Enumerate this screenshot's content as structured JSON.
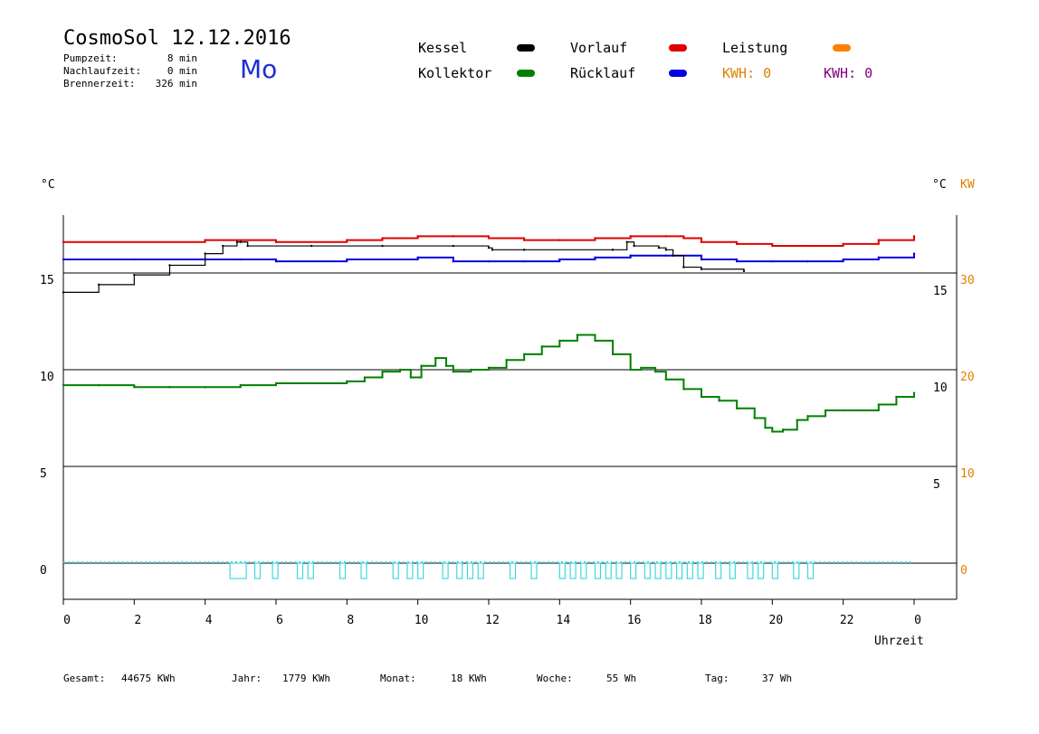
{
  "header": {
    "title": "CosmoSol 12.12.2016",
    "day": "Mo",
    "stats": [
      {
        "label": "Pumpzeit:",
        "value": "8 min"
      },
      {
        "label": "Nachlaufzeit:",
        "value": "0 min"
      },
      {
        "label": "Brennerzeit:",
        "value": "326 min"
      }
    ]
  },
  "legend": {
    "items": [
      {
        "label": "Kessel",
        "color": "#000000"
      },
      {
        "label": "Vorlauf",
        "color": "#e00000"
      },
      {
        "label": "Leistung",
        "color": "#ff8000"
      },
      {
        "label": "Kollektor",
        "color": "#008000"
      },
      {
        "label": "Rücklauf",
        "color": "#0000e0"
      }
    ],
    "kwh1": "KWH: 0",
    "kwh1_color": "#e08000",
    "kwh2": "KWH: 0",
    "kwh2_color": "#800080"
  },
  "axes": {
    "left_unit": "°C",
    "right_unit_c": "°C",
    "right_unit_kw": "KW",
    "xlabel": "Uhrzeit"
  },
  "footer": {
    "items": [
      {
        "label": "Gesamt:",
        "value": "44675 KWh"
      },
      {
        "label": "Jahr:",
        "value": "1779 KWh"
      },
      {
        "label": "Monat:",
        "value": "18 KWh"
      },
      {
        "label": "Woche:",
        "value": "55 Wh"
      },
      {
        "label": "Tag:",
        "value": "37 Wh"
      }
    ]
  },
  "chart_data": {
    "type": "line",
    "x_ticks": [
      "0",
      "2",
      "4",
      "6",
      "8",
      "10",
      "12",
      "14",
      "16",
      "18",
      "20",
      "22",
      "0"
    ],
    "xlim": [
      0,
      24
    ],
    "ylim": [
      -2,
      18
    ],
    "left_ticks": [
      0,
      5,
      10,
      15
    ],
    "right_ticks_c": [
      5,
      10,
      15
    ],
    "right_ticks_kw": [
      0,
      10,
      20,
      30
    ],
    "grid": true,
    "series": [
      {
        "name": "Vorlauf",
        "color": "#e00000",
        "x": [
          0,
          4,
          6,
          8,
          9,
          10,
          11,
          12,
          13,
          14,
          15,
          16,
          17,
          17.5,
          18,
          19,
          20,
          21,
          22,
          23,
          24
        ],
        "y": [
          16.6,
          16.7,
          16.6,
          16.7,
          16.8,
          16.9,
          16.9,
          16.8,
          16.7,
          16.7,
          16.8,
          16.9,
          16.9,
          16.8,
          16.6,
          16.5,
          16.4,
          16.4,
          16.5,
          16.7,
          16.9
        ]
      },
      {
        "name": "Rücklauf",
        "color": "#0000e0",
        "x": [
          0,
          2,
          4,
          5,
          6,
          8,
          10,
          11,
          12,
          13,
          14,
          15,
          16,
          17,
          18,
          19,
          20,
          21,
          22,
          23,
          24
        ],
        "y": [
          15.7,
          15.7,
          15.7,
          15.7,
          15.6,
          15.7,
          15.8,
          15.6,
          15.6,
          15.6,
          15.7,
          15.8,
          15.9,
          15.9,
          15.7,
          15.6,
          15.6,
          15.6,
          15.7,
          15.8,
          16.0
        ]
      },
      {
        "name": "Kessel",
        "color": "#000000",
        "x": [
          0,
          1,
          2,
          3,
          4,
          4.5,
          4.9,
          5.0,
          5.2,
          7,
          9,
          11,
          12,
          12.1,
          13,
          15.5,
          15.9,
          16.1,
          16.8,
          17.0,
          17.2,
          17.5,
          18.0,
          19.2
        ],
        "y": [
          14.0,
          14.4,
          14.9,
          15.4,
          16.0,
          16.4,
          16.6,
          16.6,
          16.4,
          16.4,
          16.4,
          16.4,
          16.3,
          16.2,
          16.2,
          16.2,
          16.6,
          16.4,
          16.3,
          16.2,
          15.9,
          15.3,
          15.2,
          15.1
        ]
      },
      {
        "name": "Kollektor",
        "color": "#008000",
        "x": [
          0,
          1,
          2,
          3,
          4,
          5,
          6,
          7,
          8,
          8.5,
          9,
          9.5,
          9.8,
          10.1,
          10.5,
          10.8,
          11,
          11.5,
          12,
          12.5,
          13,
          13.5,
          14,
          14.5,
          15,
          15.5,
          16,
          16.3,
          16.7,
          17,
          17.5,
          18,
          18.5,
          19,
          19.5,
          19.8,
          20,
          20.3,
          20.7,
          21,
          21.5,
          22,
          22.5,
          23,
          23.5,
          24
        ],
        "y": [
          9.2,
          9.2,
          9.1,
          9.1,
          9.1,
          9.2,
          9.3,
          9.3,
          9.4,
          9.6,
          9.9,
          10.0,
          9.6,
          10.2,
          10.6,
          10.2,
          9.9,
          10.0,
          10.1,
          10.5,
          10.8,
          11.2,
          11.5,
          11.8,
          11.5,
          10.8,
          10.0,
          10.1,
          9.9,
          9.5,
          9.0,
          8.6,
          8.4,
          8.0,
          7.5,
          7.0,
          6.8,
          6.9,
          7.4,
          7.6,
          7.9,
          7.9,
          7.9,
          8.2,
          8.6,
          8.8
        ]
      }
    ],
    "pump_pulses_x": [
      4.7,
      5.4,
      5.9,
      6.6,
      6.9,
      7.8,
      8.4,
      9.3,
      9.7,
      10.0,
      10.7,
      11.1,
      11.4,
      11.7,
      12.6,
      13.2,
      14.0,
      14.3,
      14.6,
      15.0,
      15.3,
      15.6,
      16.0,
      16.4,
      16.7,
      17.0,
      17.3,
      17.6,
      17.9,
      18.4,
      18.8,
      19.3,
      19.6,
      20.0,
      20.6,
      21.0
    ],
    "pump_color": "#40d8e0"
  }
}
